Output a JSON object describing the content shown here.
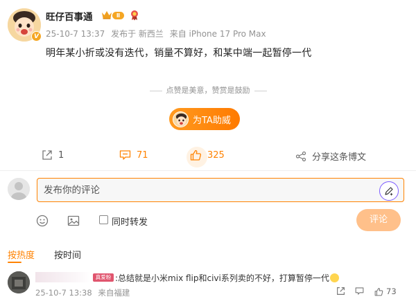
{
  "post": {
    "author": "旺仔百事通",
    "level_badge": "Ⅱ",
    "time": "25-10-7 13:37",
    "published_from": "发布于 新西兰",
    "device": "来自 iPhone 17 Pro Max",
    "text": "明年某小折或没有迭代，销量不算好，和某中端一起暂停一代"
  },
  "reward": {
    "slogan": "点赞是美意，赞赏是鼓励",
    "button_label": "为TA助威"
  },
  "actions": {
    "repost_count": "1",
    "comment_count": "71",
    "like_count": "325",
    "share_label": "分享这条博文"
  },
  "composer": {
    "placeholder": "发布你的评论",
    "repost_label": "同时转发",
    "submit_label": "评论"
  },
  "tabs": {
    "hot": "按热度",
    "time": "按时间"
  },
  "comments": [
    {
      "badge": "真爱粉",
      "text": ":总结就是小米mix flip和civi系列卖的不好，打算暂停一代",
      "time": "25-10-7 13:38",
      "location": "来自福建",
      "like_count": "73"
    }
  ],
  "colors": {
    "accent": "#ff8200",
    "muted": "#939393",
    "fan_badge": "#e0556e"
  }
}
